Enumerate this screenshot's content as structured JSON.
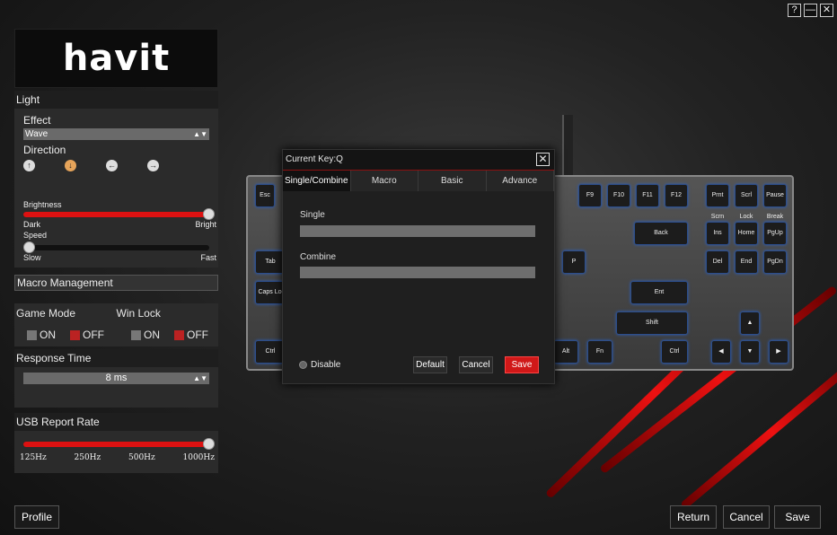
{
  "window_controls": {
    "help": "?",
    "minimize": "—",
    "close": "✕"
  },
  "logo": "havit",
  "light": {
    "title": "Light",
    "effect_label": "Effect",
    "effect_value": "Wave",
    "direction_label": "Direction",
    "directions": [
      "up-arrow",
      "down-arrow",
      "left-arrow",
      "right-arrow"
    ],
    "direction_selected": "down-arrow",
    "brightness_label": "Brightness",
    "brightness_level": 1.0,
    "brightness_min": "Dark",
    "brightness_max": "Bright",
    "speed_label": "Speed",
    "speed_level": 0.0,
    "speed_min": "Slow",
    "speed_max": "Fast"
  },
  "macro_management": "Macro Management",
  "game_mode": {
    "label": "Game Mode",
    "on": "ON",
    "off": "OFF",
    "selected": "OFF"
  },
  "win_lock": {
    "label": "Win Lock",
    "on": "ON",
    "off": "OFF",
    "selected": "OFF"
  },
  "response_time": {
    "label": "Response Time",
    "value": "8 ms"
  },
  "usb_report_rate": {
    "label": "USB Report Rate",
    "ticks": [
      "125Hz",
      "250Hz",
      "500Hz",
      "1000Hz"
    ],
    "level": 1.0
  },
  "bottom": {
    "profile": "Profile",
    "return": "Return",
    "cancel": "Cancel",
    "save": "Save"
  },
  "keyboard": {
    "keys": [
      "Esc",
      "F9",
      "F10",
      "F11",
      "F12",
      "Prnt Scrn",
      "Scrl Lock",
      "Pause Break",
      "Back",
      "Ins",
      "Home",
      "PgUp",
      "Tab",
      "P",
      "Del",
      "End",
      "PgDn",
      "Caps Lock",
      "Ent",
      "Shift",
      "Ctrl",
      "Alt",
      "Fn",
      "Ctrl"
    ]
  },
  "dialog": {
    "title": "Current Key:Q",
    "tabs": [
      "Single/Combine",
      "Macro",
      "Basic",
      "Advance"
    ],
    "active_tab": "Single/Combine",
    "single_label": "Single",
    "single_value": "",
    "combine_label": "Combine",
    "combine_value": "",
    "disable_label": "Disable",
    "default_button": "Default",
    "cancel_button": "Cancel",
    "save_button": "Save"
  },
  "colors": {
    "accent": "#d01818",
    "background": "#222222",
    "key_glow": "#2e5fb8"
  }
}
